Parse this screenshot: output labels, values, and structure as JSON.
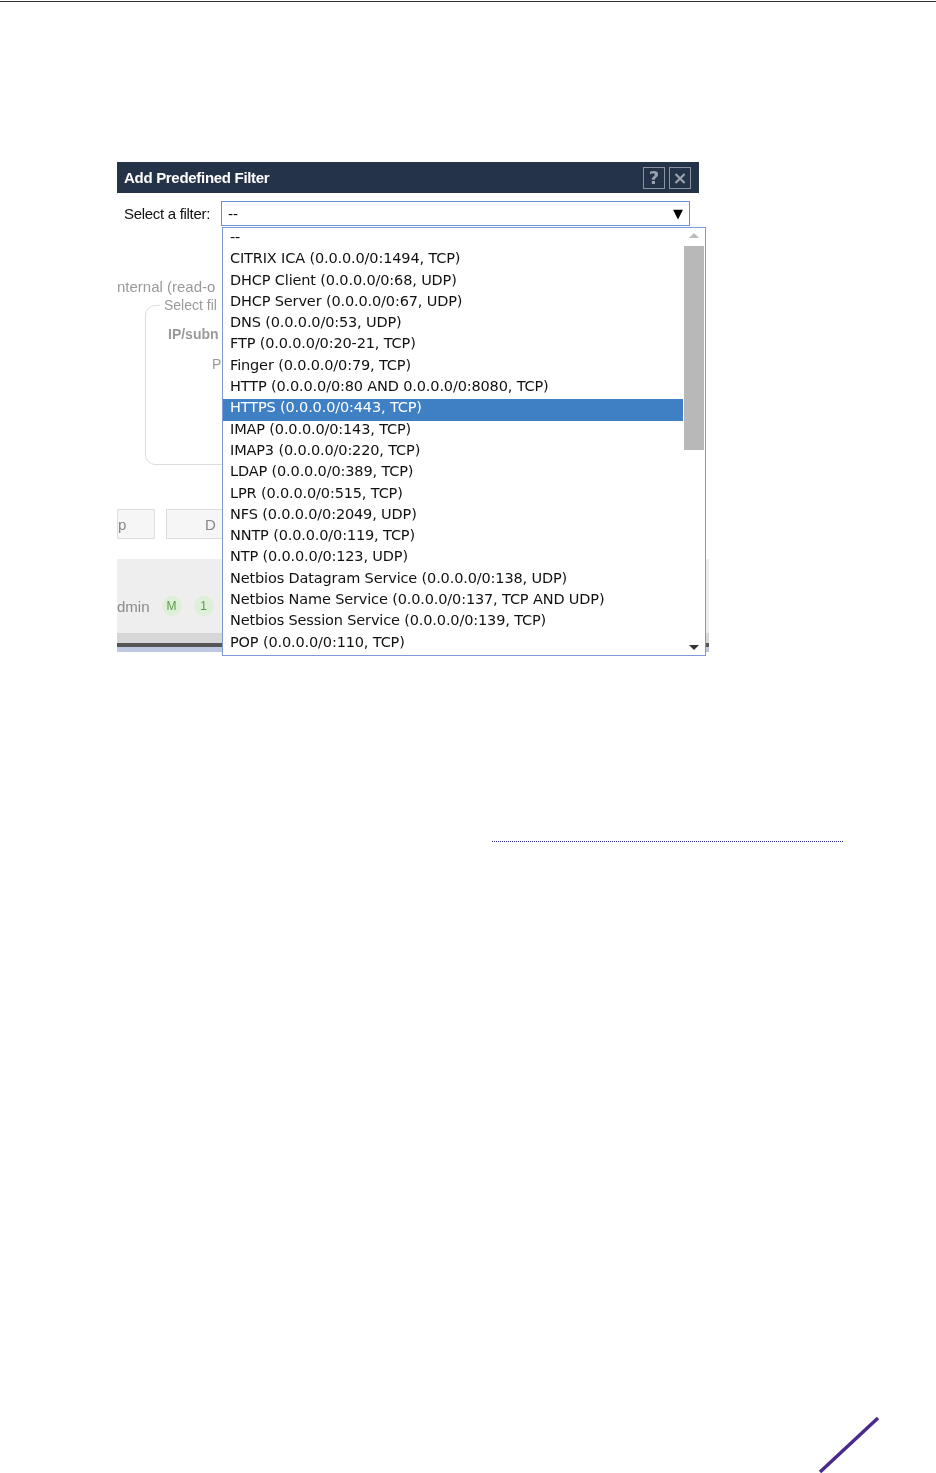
{
  "dialog": {
    "title": "Add Predefined Filter",
    "help_button": "?",
    "close_button": "×",
    "filter_label": "Select a filter:",
    "filter_value": "--",
    "filter_arrow": "▼",
    "background": {
      "section_label": "nternal (read-o",
      "group_legend": "Select fil",
      "field_labels": [
        "IP/subn",
        "P"
      ],
      "buttons": [
        "p",
        "D"
      ],
      "user": "dmin",
      "badges": [
        "M",
        "1"
      ]
    },
    "options": [
      {
        "label": "--",
        "selected": false
      },
      {
        "label": "CITRIX ICA (0.0.0.0/0:1494, TCP)",
        "selected": false
      },
      {
        "label": "DHCP Client (0.0.0.0/0:68, UDP)",
        "selected": false
      },
      {
        "label": "DHCP Server (0.0.0.0/0:67, UDP)",
        "selected": false
      },
      {
        "label": "DNS (0.0.0.0/0:53, UDP)",
        "selected": false
      },
      {
        "label": "FTP (0.0.0.0/0:20-21, TCP)",
        "selected": false
      },
      {
        "label": "Finger (0.0.0.0/0:79, TCP)",
        "selected": false
      },
      {
        "label": "HTTP (0.0.0.0/0:80 AND 0.0.0.0/0:8080, TCP)",
        "selected": false
      },
      {
        "label": "HTTPS (0.0.0.0/0:443, TCP)",
        "selected": true
      },
      {
        "label": "IMAP (0.0.0.0/0:143, TCP)",
        "selected": false
      },
      {
        "label": "IMAP3 (0.0.0.0/0:220, TCP)",
        "selected": false
      },
      {
        "label": "LDAP (0.0.0.0/0:389, TCP)",
        "selected": false
      },
      {
        "label": "LPR (0.0.0.0/0:515, TCP)",
        "selected": false
      },
      {
        "label": "NFS (0.0.0.0/0:2049, UDP)",
        "selected": false
      },
      {
        "label": "NNTP (0.0.0.0/0:119, TCP)",
        "selected": false
      },
      {
        "label": "NTP (0.0.0.0/0:123, UDP)",
        "selected": false
      },
      {
        "label": "Netbios Datagram Service (0.0.0.0/0:138, UDP)",
        "selected": false
      },
      {
        "label": "Netbios Name Service (0.0.0.0/0:137, TCP AND UDP)",
        "selected": false
      },
      {
        "label": "Netbios Session Service (0.0.0.0/0:139, TCP)",
        "selected": false
      },
      {
        "label": "POP (0.0.0.0/0:110, TCP)",
        "selected": false
      }
    ]
  }
}
